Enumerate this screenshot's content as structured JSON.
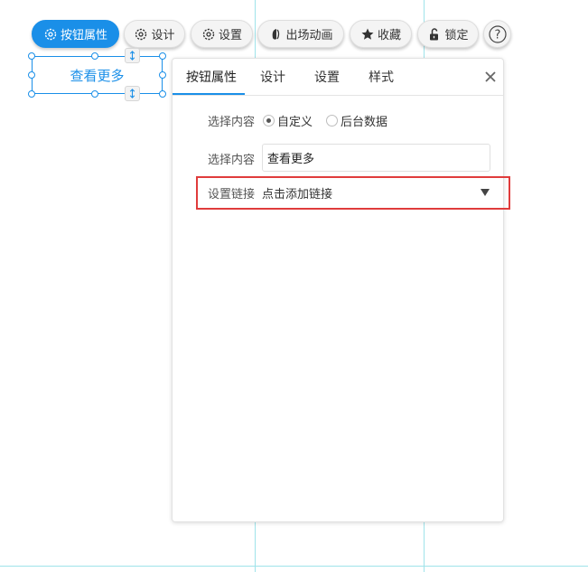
{
  "toolbar": {
    "buttons": [
      {
        "label": "按钮属性",
        "icon": "gear-icon",
        "active": true
      },
      {
        "label": "设计",
        "icon": "gear-icon",
        "active": false
      },
      {
        "label": "设置",
        "icon": "gear-icon",
        "active": false
      },
      {
        "label": "出场动画",
        "icon": "animation-icon",
        "active": false
      },
      {
        "label": "收藏",
        "icon": "star-icon",
        "active": false
      },
      {
        "label": "锁定",
        "icon": "unlock-icon",
        "active": false
      }
    ],
    "help_label": "?"
  },
  "canvas": {
    "selected_button_text": "查看更多"
  },
  "panel": {
    "tabs": [
      "按钮属性",
      "设计",
      "设置",
      "样式"
    ],
    "active_tab": "按钮属性",
    "content_source": {
      "label": "选择内容",
      "options": [
        "自定义",
        "后台数据"
      ],
      "selected": "自定义"
    },
    "content_text": {
      "label": "选择内容",
      "value": "查看更多"
    },
    "link": {
      "label": "设置链接",
      "value": "点击添加链接"
    }
  },
  "colors": {
    "accent": "#1a8fe8",
    "highlight": "#e03c3c",
    "guide": "#9fe3ea"
  }
}
